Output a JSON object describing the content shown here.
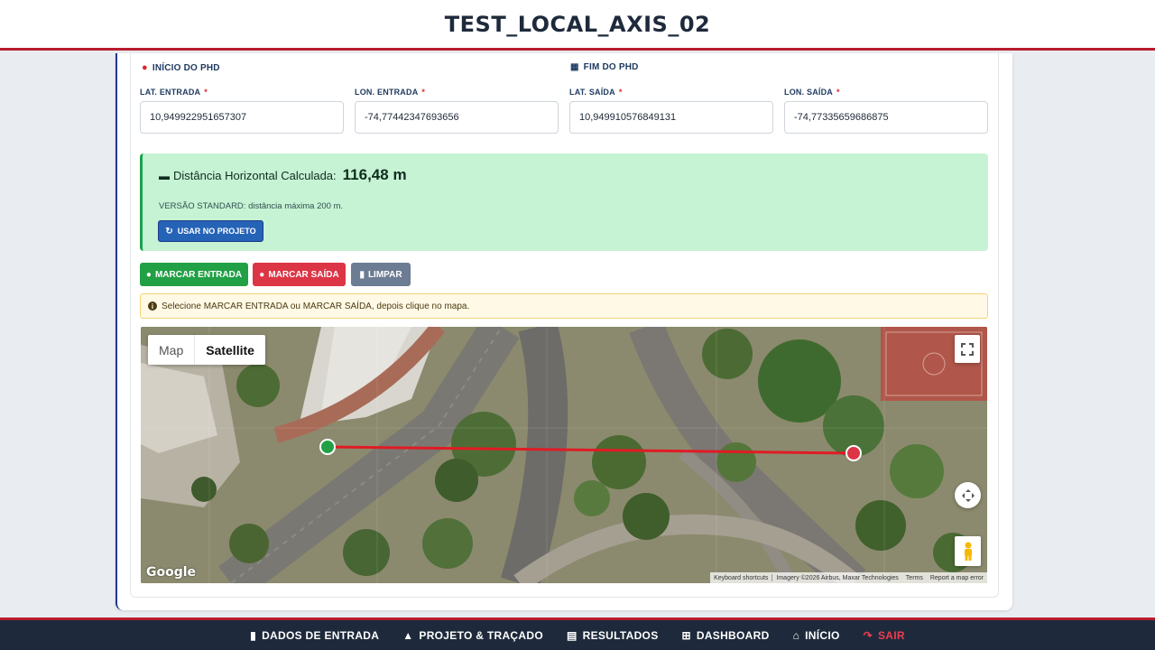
{
  "header": {
    "title": "TEST_LOCAL_AXIS_02"
  },
  "start": {
    "title": "INÍCIO DO PHD",
    "lat_label": "LAT. ENTRADA",
    "lat_value": "10,949922951657307",
    "lon_label": "LON. ENTRADA",
    "lon_value": "-74,77442347693656"
  },
  "end": {
    "title": "FIM DO PHD",
    "lat_label": "LAT. SAÍDA",
    "lat_value": "10,949910576849131",
    "lon_label": "LON. SAÍDA",
    "lon_value": "-74,77335659686875"
  },
  "required_mark": "*",
  "result": {
    "label": "Distância Horizontal Calculada:",
    "value": "116,48 m",
    "note": "VERSÃO STANDARD: distância máxima 200 m.",
    "use_button": "USAR NO PROJETO"
  },
  "actions": {
    "mark_entry": "MARCAR ENTRADA",
    "mark_exit": "MARCAR SAÍDA",
    "clear": "LIMPAR"
  },
  "hint": "Selecione MARCAR ENTRADA ou MARCAR SAÍDA, depois clique no mapa.",
  "map": {
    "type_map": "Map",
    "type_satellite": "Satellite",
    "selected_type": "Satellite",
    "logo": "Google",
    "attribution": {
      "shortcuts": "Keyboard shortcuts",
      "imagery": "Imagery ©2026 Airbus, Maxar Technologies",
      "terms": "Terms",
      "report": "Report a map error"
    },
    "colors": {
      "entry_marker": "#22a046",
      "exit_marker": "#dc3545",
      "line": "#e01b24"
    }
  },
  "nav": {
    "items": [
      {
        "label": "DADOS DE ENTRADA",
        "icon": "clipboard-icon"
      },
      {
        "label": "PROJETO & TRAÇADO",
        "icon": "route-icon"
      },
      {
        "label": "RESULTADOS",
        "icon": "chart-icon"
      },
      {
        "label": "DASHBOARD",
        "icon": "grid-icon"
      },
      {
        "label": "INÍCIO",
        "icon": "home-icon"
      },
      {
        "label": "SAIR",
        "icon": "logout-icon"
      }
    ]
  },
  "colors": {
    "accent_red": "#b91c2e",
    "navy": "#1e2a3b",
    "success_bg": "#c6f3d4"
  }
}
